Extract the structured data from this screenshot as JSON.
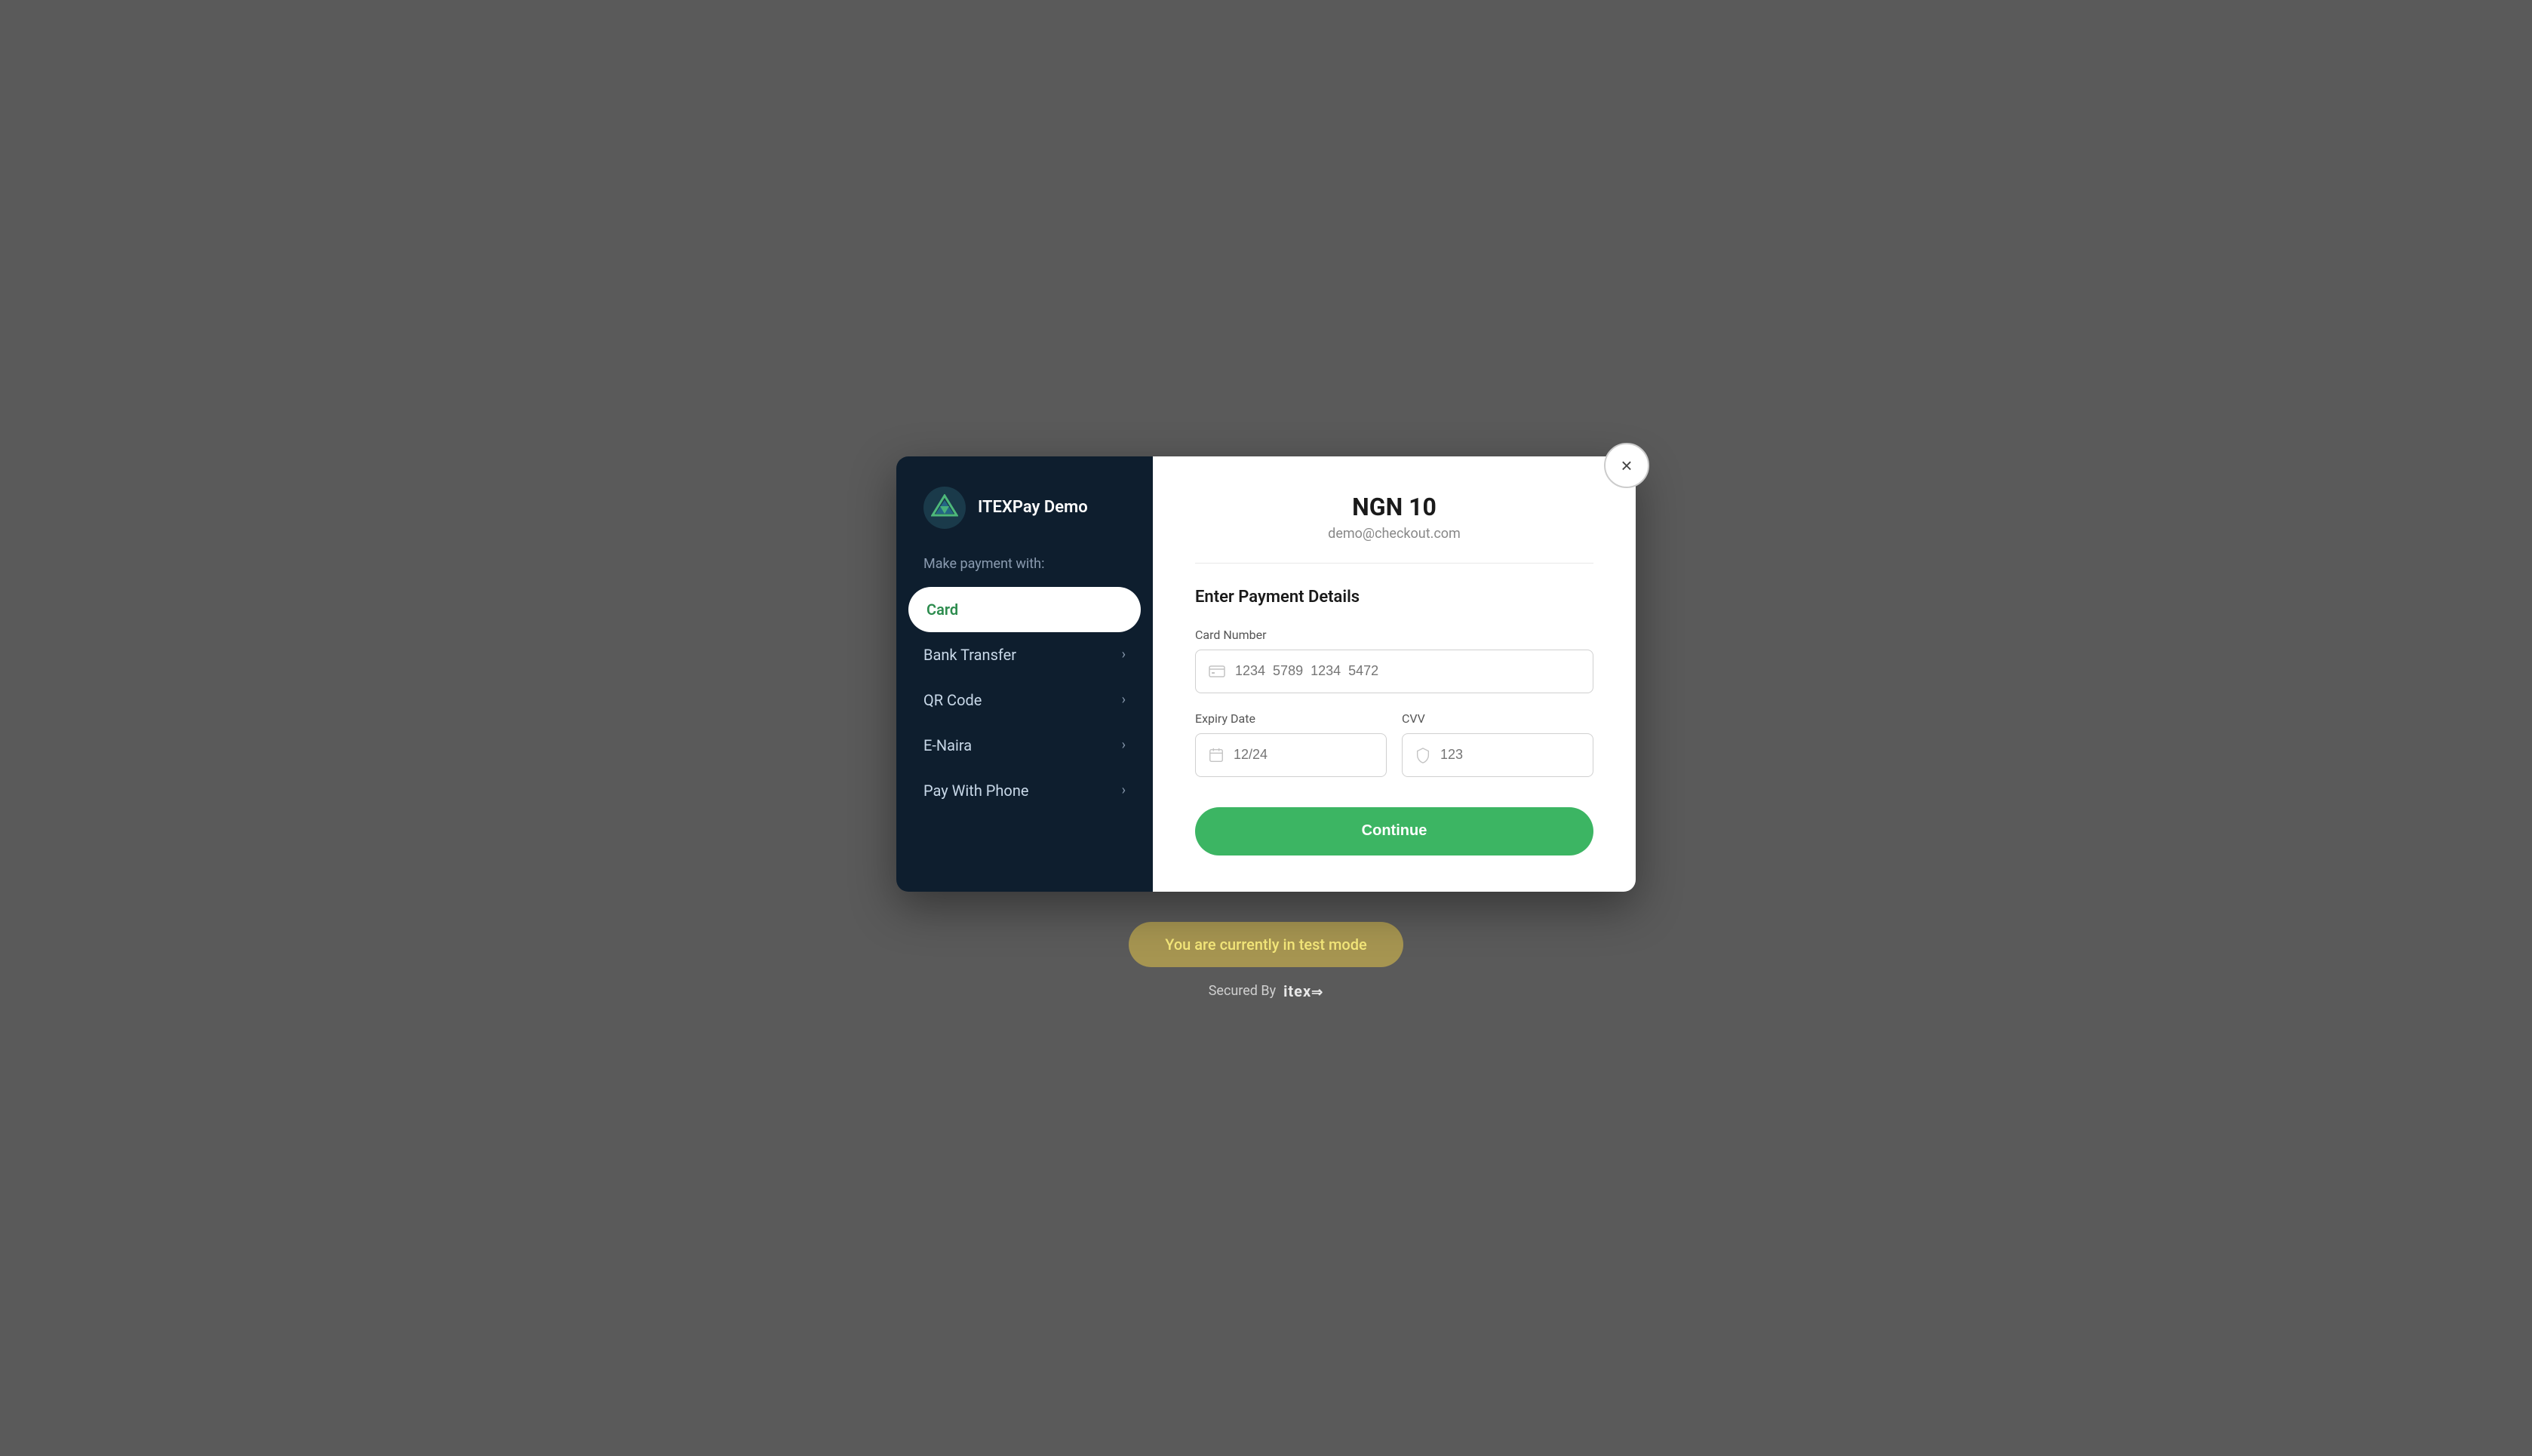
{
  "brand": {
    "name": "ITEXPay Demo"
  },
  "sidebar": {
    "make_payment_label": "Make payment with:",
    "items": [
      {
        "id": "card",
        "label": "Card",
        "active": true
      },
      {
        "id": "bank-transfer",
        "label": "Bank Transfer",
        "active": false
      },
      {
        "id": "qr-code",
        "label": "QR Code",
        "active": false
      },
      {
        "id": "e-naira",
        "label": "E-Naira",
        "active": false
      },
      {
        "id": "pay-with-phone",
        "label": "Pay With Phone",
        "active": false
      }
    ]
  },
  "payment": {
    "amount": "NGN 10",
    "email": "demo@checkout.com",
    "section_title": "Enter Payment Details",
    "card_number_label": "Card Number",
    "card_number_placeholder": "1234  5789  1234  5472",
    "expiry_label": "Expiry Date",
    "expiry_placeholder": "12/24",
    "cvv_label": "CVV",
    "cvv_placeholder": "123",
    "continue_button": "Continue"
  },
  "footer": {
    "test_mode_text": "You are currently in test mode",
    "secured_by": "Secured By",
    "brand": "itex"
  },
  "close_button_label": "×"
}
